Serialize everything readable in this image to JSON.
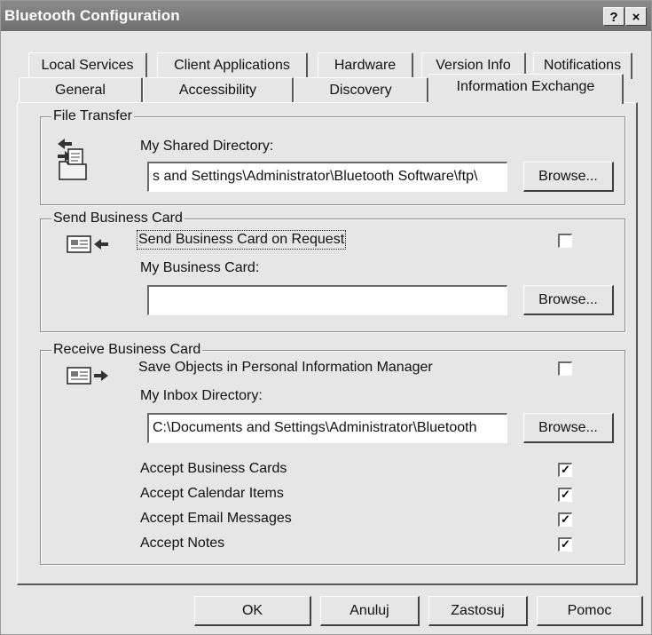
{
  "window": {
    "title": "Bluetooth Configuration",
    "help_label": "?",
    "close_label": "×"
  },
  "tabs": {
    "row1": [
      "Local Services",
      "Client Applications",
      "Hardware",
      "Version Info",
      "Notifications"
    ],
    "row2": [
      "General",
      "Accessibility",
      "Discovery",
      "Information Exchange"
    ],
    "active": "Information Exchange"
  },
  "file_transfer": {
    "legend": "File Transfer",
    "dir_label": "My Shared Directory:",
    "dir_value": "s and Settings\\Administrator\\Bluetooth Software\\ftp\\",
    "browse_label": "Browse...",
    "icon": "file-transfer-icon"
  },
  "send_card": {
    "legend": "Send Business Card",
    "checkbox_label": "Send Business Card on Request",
    "checkbox_checked": false,
    "card_label": "My Business Card:",
    "card_value": "",
    "browse_label": "Browse...",
    "icon": "send-card-icon"
  },
  "receive_card": {
    "legend": "Receive Business Card",
    "save_label": "Save Objects in Personal Information Manager",
    "save_checked": false,
    "inbox_label": "My Inbox Directory:",
    "inbox_value": "C:\\Documents and Settings\\Administrator\\Bluetooth",
    "browse_label": "Browse...",
    "icon": "receive-card-icon",
    "accept": [
      {
        "label": "Accept Business Cards",
        "checked": true
      },
      {
        "label": "Accept Calendar Items",
        "checked": true
      },
      {
        "label": "Accept Email Messages",
        "checked": true
      },
      {
        "label": "Accept Notes",
        "checked": true
      }
    ]
  },
  "buttons": {
    "ok": "OK",
    "cancel": "Anuluj",
    "apply": "Zastosuj",
    "help": "Pomoc"
  }
}
